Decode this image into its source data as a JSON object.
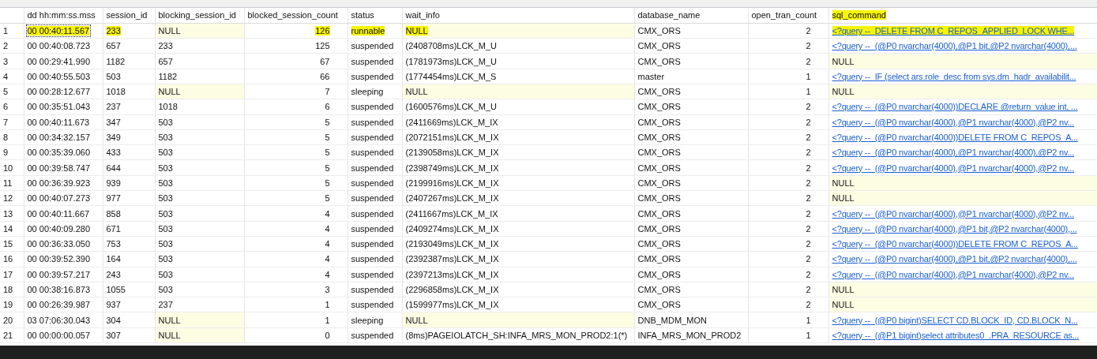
{
  "table": {
    "columns": [
      {
        "label": "dd hh:mm:ss.mss",
        "kind": "text",
        "highlighted": false
      },
      {
        "label": "session_id",
        "kind": "text",
        "highlighted": false
      },
      {
        "label": "blocking_session_id",
        "kind": "text",
        "highlighted": false
      },
      {
        "label": "blocked_session_count",
        "kind": "numeric",
        "highlighted": false
      },
      {
        "label": "status",
        "kind": "text",
        "highlighted": false
      },
      {
        "label": "wait_info",
        "kind": "text",
        "highlighted": false
      },
      {
        "label": "database_name",
        "kind": "text",
        "highlighted": false
      },
      {
        "label": "open_tran_count",
        "kind": "numeric",
        "highlighted": false
      },
      {
        "label": "sql_command",
        "kind": "link",
        "highlighted": true
      }
    ],
    "rows": [
      {
        "number": "1",
        "cells": [
          "00 00:40:11.567",
          "233",
          "NULL",
          "126",
          "runnable",
          "NULL",
          "CMX_ORS",
          "2",
          "<?query --  DELETE FROM C_REPOS_APPLIED_LOCK WHE..."
        ],
        "null": [
          false,
          false,
          true,
          false,
          false,
          true,
          false,
          false,
          false
        ],
        "highlighted": [
          true,
          true,
          false,
          true,
          true,
          true,
          false,
          false,
          true
        ],
        "focused": [
          true,
          false,
          false,
          false,
          false,
          false,
          false,
          false,
          false
        ]
      },
      {
        "number": "2",
        "cells": [
          "00 00:40:08.723",
          "657",
          "233",
          "125",
          "suspended",
          "(2408708ms)LCK_M_U",
          "CMX_ORS",
          "2",
          "<?query --  (@P0 nvarchar(4000),@P1 bit,@P2 nvarchar(4000),..."
        ],
        "null": [
          false,
          false,
          false,
          false,
          false,
          false,
          false,
          false,
          false
        ],
        "highlighted": [
          false,
          false,
          false,
          false,
          false,
          false,
          false,
          false,
          false
        ]
      },
      {
        "number": "3",
        "cells": [
          "00 00:29:41.990",
          "1182",
          "657",
          "67",
          "suspended",
          "(1781973ms)LCK_M_U",
          "CMX_ORS",
          "2",
          "NULL"
        ],
        "null": [
          false,
          false,
          false,
          false,
          false,
          false,
          false,
          false,
          true
        ],
        "highlighted": [
          false,
          false,
          false,
          false,
          false,
          false,
          false,
          false,
          false
        ]
      },
      {
        "number": "4",
        "cells": [
          "00 00:40:55.503",
          "503",
          "1182",
          "66",
          "suspended",
          "(1774454ms)LCK_M_S",
          "master",
          "1",
          "<?query --  IF (select ars.role_desc from sys.dm_hadr_availabilit..."
        ],
        "null": [
          false,
          false,
          false,
          false,
          false,
          false,
          false,
          false,
          false
        ],
        "highlighted": [
          false,
          false,
          false,
          false,
          false,
          false,
          false,
          false,
          false
        ]
      },
      {
        "number": "5",
        "cells": [
          "00 00:28:12.677",
          "1018",
          "NULL",
          "7",
          "sleeping",
          "NULL",
          "CMX_ORS",
          "1",
          "NULL"
        ],
        "null": [
          false,
          false,
          true,
          false,
          false,
          true,
          false,
          false,
          true
        ],
        "highlighted": [
          false,
          false,
          false,
          false,
          false,
          false,
          false,
          false,
          false
        ]
      },
      {
        "number": "6",
        "cells": [
          "00 00:35:51.043",
          "237",
          "1018",
          "6",
          "suspended",
          "(1600576ms)LCK_M_U",
          "CMX_ORS",
          "2",
          "<?query --  (@P0 nvarchar(4000))DECLARE @return_value int, ..."
        ],
        "null": [
          false,
          false,
          false,
          false,
          false,
          false,
          false,
          false,
          false
        ],
        "highlighted": [
          false,
          false,
          false,
          false,
          false,
          false,
          false,
          false,
          false
        ]
      },
      {
        "number": "7",
        "cells": [
          "00 00:40:11.673",
          "347",
          "503",
          "5",
          "suspended",
          "(2411669ms)LCK_M_IX",
          "CMX_ORS",
          "2",
          "<?query --  (@P0 nvarchar(4000),@P1 nvarchar(4000),@P2 nv..."
        ],
        "null": [
          false,
          false,
          false,
          false,
          false,
          false,
          false,
          false,
          false
        ],
        "highlighted": [
          false,
          false,
          false,
          false,
          false,
          false,
          false,
          false,
          false
        ]
      },
      {
        "number": "8",
        "cells": [
          "00 00:34:32.157",
          "349",
          "503",
          "5",
          "suspended",
          "(2072151ms)LCK_M_IX",
          "CMX_ORS",
          "2",
          "<?query --  (@P0 nvarchar(4000))DELETE FROM C_REPOS_A..."
        ],
        "null": [
          false,
          false,
          false,
          false,
          false,
          false,
          false,
          false,
          false
        ],
        "highlighted": [
          false,
          false,
          false,
          false,
          false,
          false,
          false,
          false,
          false
        ]
      },
      {
        "number": "9",
        "cells": [
          "00 00:35:39.060",
          "433",
          "503",
          "5",
          "suspended",
          "(2139058ms)LCK_M_IX",
          "CMX_ORS",
          "2",
          "<?query --  (@P0 nvarchar(4000),@P1 nvarchar(4000),@P2 nv..."
        ],
        "null": [
          false,
          false,
          false,
          false,
          false,
          false,
          false,
          false,
          false
        ],
        "highlighted": [
          false,
          false,
          false,
          false,
          false,
          false,
          false,
          false,
          false
        ]
      },
      {
        "number": "10",
        "cells": [
          "00 00:39:58.747",
          "644",
          "503",
          "5",
          "suspended",
          "(2398749ms)LCK_M_IX",
          "CMX_ORS",
          "2",
          "<?query --  (@P0 nvarchar(4000),@P1 nvarchar(4000),@P2 nv..."
        ],
        "null": [
          false,
          false,
          false,
          false,
          false,
          false,
          false,
          false,
          false
        ],
        "highlighted": [
          false,
          false,
          false,
          false,
          false,
          false,
          false,
          false,
          false
        ]
      },
      {
        "number": "11",
        "cells": [
          "00 00:36:39.923",
          "939",
          "503",
          "5",
          "suspended",
          "(2199916ms)LCK_M_IX",
          "CMX_ORS",
          "2",
          "NULL"
        ],
        "null": [
          false,
          false,
          false,
          false,
          false,
          false,
          false,
          false,
          true
        ],
        "highlighted": [
          false,
          false,
          false,
          false,
          false,
          false,
          false,
          false,
          false
        ]
      },
      {
        "number": "12",
        "cells": [
          "00 00:40:07.273",
          "977",
          "503",
          "5",
          "suspended",
          "(2407267ms)LCK_M_IX",
          "CMX_ORS",
          "2",
          "NULL"
        ],
        "null": [
          false,
          false,
          false,
          false,
          false,
          false,
          false,
          false,
          true
        ],
        "highlighted": [
          false,
          false,
          false,
          false,
          false,
          false,
          false,
          false,
          false
        ]
      },
      {
        "number": "13",
        "cells": [
          "00 00:40:11.667",
          "858",
          "503",
          "4",
          "suspended",
          "(2411667ms)LCK_M_IX",
          "CMX_ORS",
          "2",
          "<?query --  (@P0 nvarchar(4000),@P1 nvarchar(4000),@P2 nv..."
        ],
        "null": [
          false,
          false,
          false,
          false,
          false,
          false,
          false,
          false,
          false
        ],
        "highlighted": [
          false,
          false,
          false,
          false,
          false,
          false,
          false,
          false,
          false
        ]
      },
      {
        "number": "14",
        "cells": [
          "00 00:40:09.280",
          "671",
          "503",
          "4",
          "suspended",
          "(2409274ms)LCK_M_IX",
          "CMX_ORS",
          "2",
          "<?query --  (@P0 nvarchar(4000),@P1 bit,@P2 nvarchar(4000),..."
        ],
        "null": [
          false,
          false,
          false,
          false,
          false,
          false,
          false,
          false,
          false
        ],
        "highlighted": [
          false,
          false,
          false,
          false,
          false,
          false,
          false,
          false,
          false
        ]
      },
      {
        "number": "15",
        "cells": [
          "00 00:36:33.050",
          "753",
          "503",
          "4",
          "suspended",
          "(2193049ms)LCK_M_IX",
          "CMX_ORS",
          "2",
          "<?query --  (@P0 nvarchar(4000))DELETE FROM C_REPOS_A..."
        ],
        "null": [
          false,
          false,
          false,
          false,
          false,
          false,
          false,
          false,
          false
        ],
        "highlighted": [
          false,
          false,
          false,
          false,
          false,
          false,
          false,
          false,
          false
        ]
      },
      {
        "number": "16",
        "cells": [
          "00 00:39:52.390",
          "164",
          "503",
          "4",
          "suspended",
          "(2392387ms)LCK_M_IX",
          "CMX_ORS",
          "2",
          "<?query --  (@P0 nvarchar(4000),@P1 bit,@P2 nvarchar(4000),..."
        ],
        "null": [
          false,
          false,
          false,
          false,
          false,
          false,
          false,
          false,
          false
        ],
        "highlighted": [
          false,
          false,
          false,
          false,
          false,
          false,
          false,
          false,
          false
        ]
      },
      {
        "number": "17",
        "cells": [
          "00 00:39:57.217",
          "243",
          "503",
          "4",
          "suspended",
          "(2397213ms)LCK_M_IX",
          "CMX_ORS",
          "2",
          "<?query --  (@P0 nvarchar(4000),@P1 nvarchar(4000),@P2 nv..."
        ],
        "null": [
          false,
          false,
          false,
          false,
          false,
          false,
          false,
          false,
          false
        ],
        "highlighted": [
          false,
          false,
          false,
          false,
          false,
          false,
          false,
          false,
          false
        ]
      },
      {
        "number": "18",
        "cells": [
          "00 00:38:16.873",
          "1055",
          "503",
          "3",
          "suspended",
          "(2296858ms)LCK_M_IX",
          "CMX_ORS",
          "2",
          "NULL"
        ],
        "null": [
          false,
          false,
          false,
          false,
          false,
          false,
          false,
          false,
          true
        ],
        "highlighted": [
          false,
          false,
          false,
          false,
          false,
          false,
          false,
          false,
          false
        ]
      },
      {
        "number": "19",
        "cells": [
          "00 00:26:39.987",
          "937",
          "237",
          "1",
          "suspended",
          "(1599977ms)LCK_M_IX",
          "CMX_ORS",
          "2",
          "NULL"
        ],
        "null": [
          false,
          false,
          false,
          false,
          false,
          false,
          false,
          false,
          true
        ],
        "highlighted": [
          false,
          false,
          false,
          false,
          false,
          false,
          false,
          false,
          false
        ]
      },
      {
        "number": "20",
        "cells": [
          "03 07:06:30.043",
          "304",
          "NULL",
          "1",
          "sleeping",
          "NULL",
          "DNB_MDM_MON",
          "1",
          "<?query --  (@P0 bigint)SELECT CD.BLOCK_ID, CD.BLOCK_N..."
        ],
        "null": [
          false,
          false,
          true,
          false,
          false,
          true,
          false,
          false,
          false
        ],
        "highlighted": [
          false,
          false,
          false,
          false,
          false,
          false,
          false,
          false,
          false
        ]
      },
      {
        "number": "21",
        "cells": [
          "00 00:00:00.057",
          "307",
          "NULL",
          "0",
          "suspended",
          "(8ms)PAGEIOLATCH_SH:INFA_MRS_MON_PROD2:1(*)",
          "INFA_MRS_MON_PROD2",
          "1",
          "<?query --  (@P1 bigint)select attributes0_.PRA_RESOURCE as..."
        ],
        "null": [
          false,
          false,
          true,
          false,
          false,
          false,
          false,
          false,
          false
        ],
        "highlighted": [
          false,
          false,
          false,
          false,
          false,
          false,
          false,
          false,
          false
        ]
      }
    ]
  }
}
